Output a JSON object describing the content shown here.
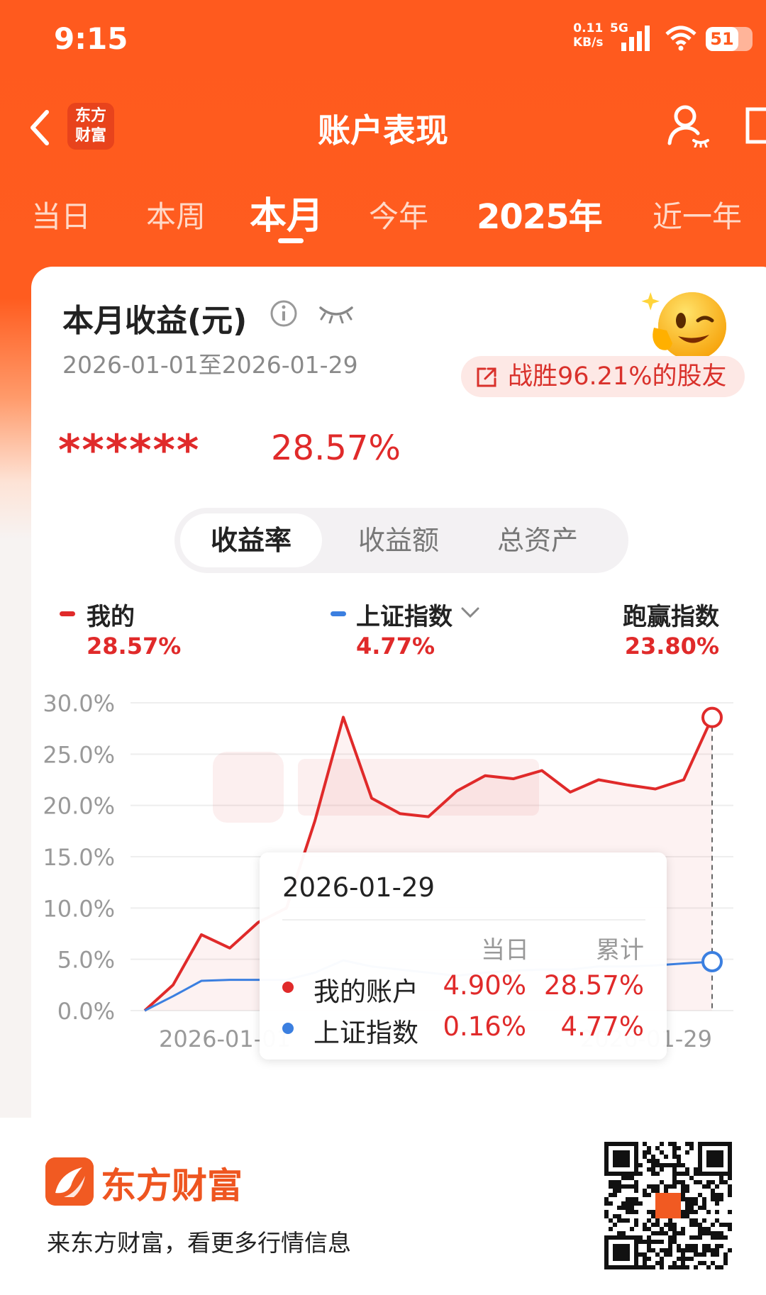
{
  "status_bar": {
    "time": "9:15",
    "speed_value": "0.11",
    "speed_unit": "KB/s",
    "network": "5G",
    "battery": "51"
  },
  "header": {
    "logo_text_line1": "东方",
    "logo_text_line2": "财富",
    "title": "账户表现"
  },
  "period_tabs": [
    {
      "label": "当日"
    },
    {
      "label": "本周"
    },
    {
      "label": "本月",
      "active": true
    },
    {
      "label": "今年"
    },
    {
      "label": "2025年"
    },
    {
      "label": "近一年"
    }
  ],
  "summary": {
    "title": "本月收益(元)",
    "date_range": "2026-01-01至2026-01-29",
    "beat_text": "战胜96.21%的股友",
    "masked_amount": "******",
    "return_pct": "28.57%"
  },
  "metric_tabs": [
    {
      "label": "收益率",
      "active": true
    },
    {
      "label": "收益额"
    },
    {
      "label": "总资产"
    }
  ],
  "legend": {
    "mine_label": "我的",
    "mine_value": "28.57%",
    "index_label": "上证指数",
    "index_value": "4.77%",
    "beat_label": "跑赢指数",
    "beat_value": "23.80%"
  },
  "colors": {
    "mine": "#e02a2a",
    "index": "#3b7fe0",
    "brand": "#ff5a1e"
  },
  "chart_data": {
    "type": "area",
    "x_start_label": "2026-01-01",
    "x_end_label": "2026-01-29",
    "y_tick_labels": [
      "30.0%",
      "25.0%",
      "20.0%",
      "15.0%",
      "10.0%",
      "5.0%",
      "0.0%"
    ],
    "ylim": [
      0,
      30
    ],
    "series": [
      {
        "name": "我的",
        "values": [
          0.0,
          2.5,
          7.4,
          6.1,
          8.6,
          10.0,
          18.5,
          28.6,
          20.7,
          19.2,
          18.9,
          21.4,
          22.9,
          22.6,
          23.4,
          21.3,
          22.5,
          22.0,
          21.6,
          22.5,
          28.57
        ]
      },
      {
        "name": "上证指数",
        "values": [
          0.0,
          1.4,
          2.9,
          3.0,
          3.0,
          3.0,
          3.7,
          4.9,
          4.3,
          4.0,
          3.7,
          3.4,
          3.7,
          3.9,
          4.0,
          4.0,
          4.3,
          4.3,
          4.4,
          4.6,
          4.77
        ]
      }
    ],
    "grid": true
  },
  "tooltip": {
    "date": "2026-01-29",
    "col_day": "当日",
    "col_total": "累计",
    "rows": [
      {
        "name": "我的账户",
        "day": "4.90%",
        "total": "28.57%"
      },
      {
        "name": "上证指数",
        "day": "0.16%",
        "total": "4.77%"
      }
    ]
  },
  "footer": {
    "brand": "东方财富",
    "slogan": "来东方财富，看更多行情信息"
  }
}
